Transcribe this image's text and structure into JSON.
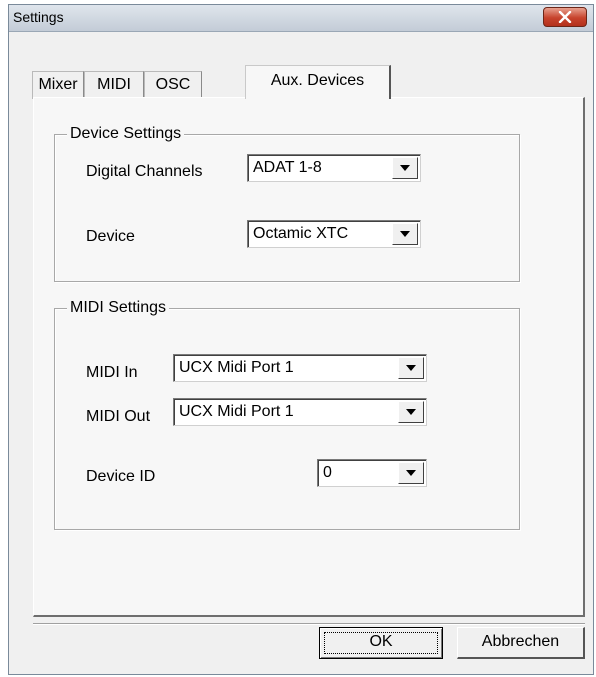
{
  "window": {
    "title": "Settings"
  },
  "tabs": [
    {
      "label": "Mixer"
    },
    {
      "label": "MIDI"
    },
    {
      "label": "OSC"
    },
    {
      "label": "Aux. Devices"
    }
  ],
  "active_tab": "Aux. Devices",
  "device_settings": {
    "legend": "Device Settings",
    "digital_channels": {
      "label": "Digital Channels",
      "value": "ADAT 1-8"
    },
    "device": {
      "label": "Device",
      "value": "Octamic XTC"
    }
  },
  "midi_settings": {
    "legend": "MIDI Settings",
    "midi_in": {
      "label": "MIDI In",
      "value": "UCX Midi Port 1"
    },
    "midi_out": {
      "label": "MIDI Out",
      "value": "UCX Midi Port 1"
    },
    "device_id": {
      "label": "Device ID",
      "value": "0"
    }
  },
  "buttons": {
    "ok": "OK",
    "cancel": "Abbrechen"
  },
  "icons": {
    "close": "close-icon",
    "dropdown": "chevron-down-icon"
  },
  "colors": {
    "close_button": "#c7432c",
    "dialog_bg": "#f0f0f0"
  }
}
